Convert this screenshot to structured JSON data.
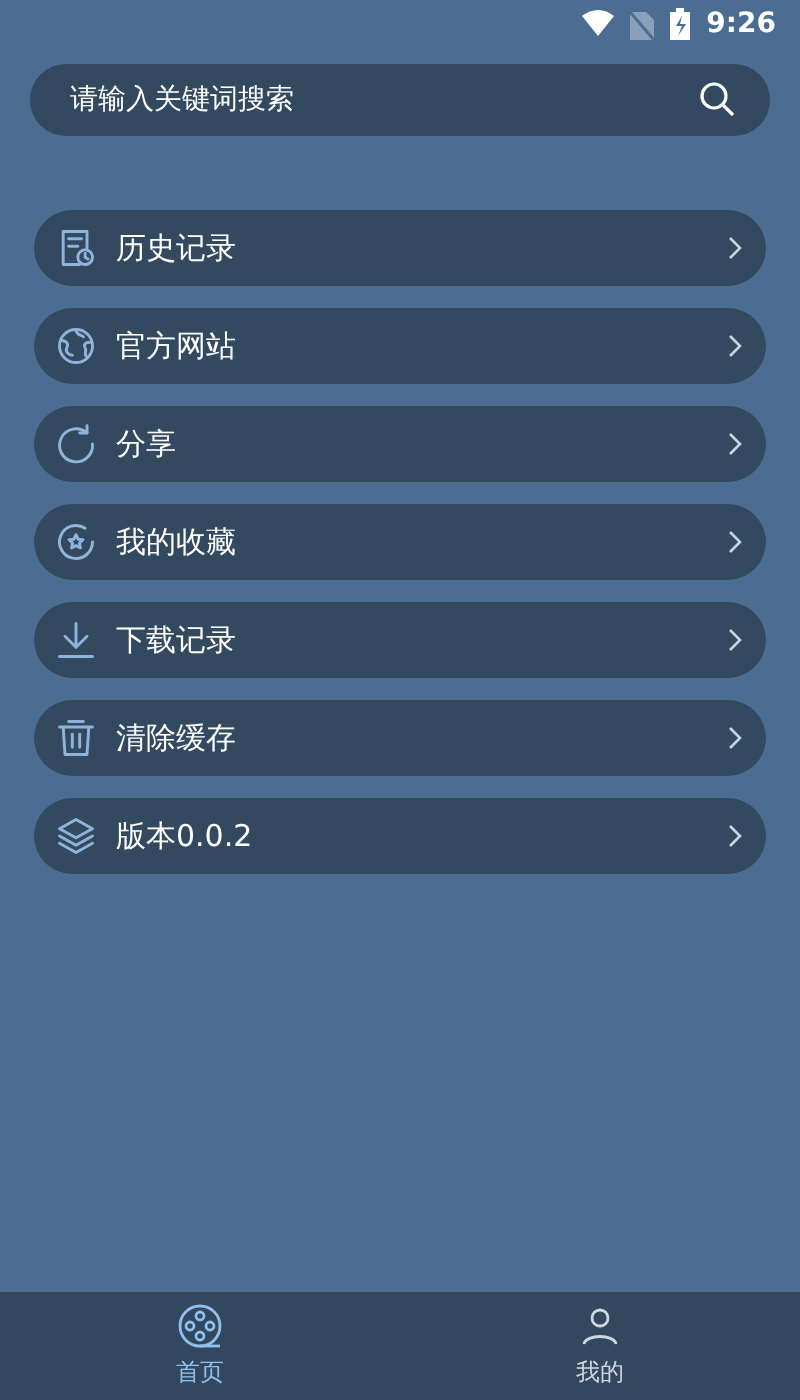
{
  "status_bar": {
    "time": "9:26"
  },
  "search": {
    "placeholder": "请输入关键词搜索"
  },
  "menu": [
    {
      "kind": "history",
      "label": "历史记录"
    },
    {
      "kind": "website",
      "label": "官方网站"
    },
    {
      "kind": "share",
      "label": "分享"
    },
    {
      "kind": "favorites",
      "label": "我的收藏"
    },
    {
      "kind": "download",
      "label": "下载记录"
    },
    {
      "kind": "clear",
      "label": "清除缓存"
    },
    {
      "kind": "version",
      "label": "版本0.0.2"
    }
  ],
  "tabs": [
    {
      "kind": "home",
      "label": "首页",
      "selected": true
    },
    {
      "kind": "mine",
      "label": "我的",
      "selected": false
    }
  ]
}
